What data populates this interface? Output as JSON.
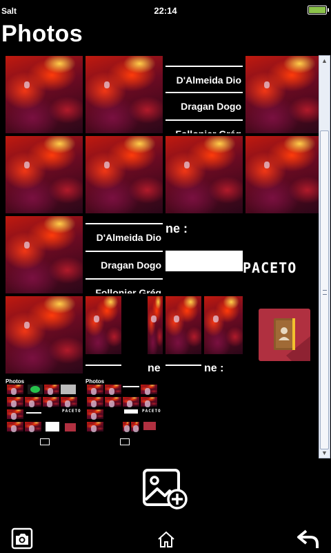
{
  "status": {
    "carrier": "Salt",
    "time": "22:14"
  },
  "header": {
    "title": "Photos"
  },
  "names": [
    "D'Almeida Dio",
    "Dragan Dogo",
    "Follonier Grég"
  ],
  "field_label": "ne :",
  "pace_text": "PACETO",
  "mini_title": "Photos",
  "icons": {
    "contact": "contacts-book-icon",
    "add_photo": "add-photo-icon",
    "camera": "camera-icon",
    "home": "home-icon",
    "back": "back-arrow-icon"
  },
  "colors": {
    "accent": "#b03040",
    "scrollbar": "#e9eef6",
    "battery": "#8bc34a"
  }
}
